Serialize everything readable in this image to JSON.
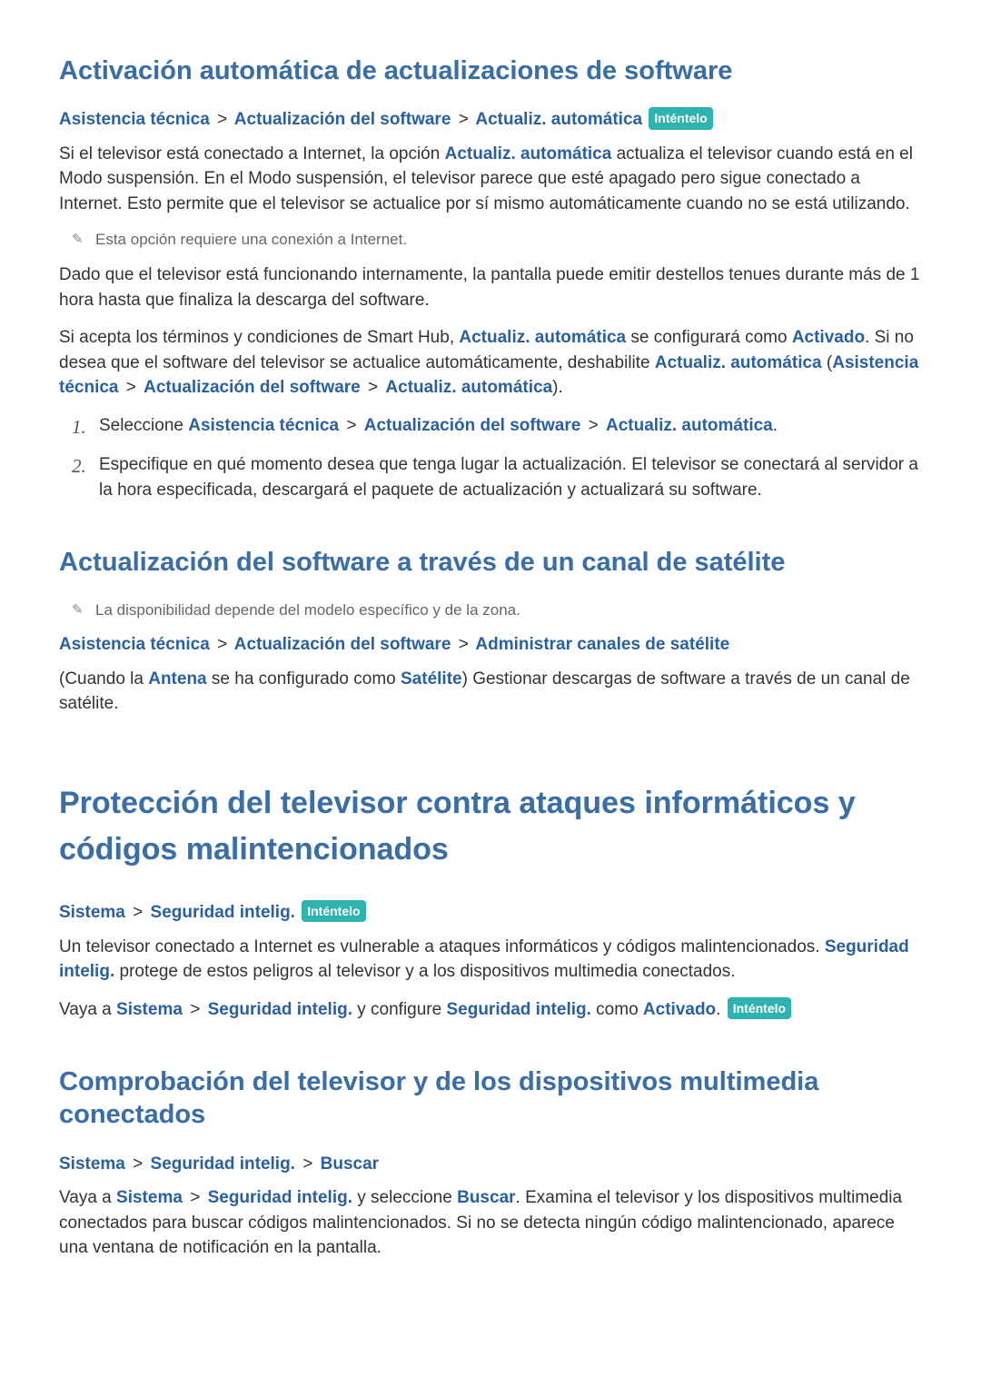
{
  "sec1": {
    "title": "Activación automática de actualizaciones de software",
    "bc": {
      "a": "Asistencia técnica",
      "b": "Actualización del software",
      "c": "Actualiz. automática",
      "try": "Inténtelo"
    },
    "p1_a": "Si el televisor está conectado a Internet, la opción ",
    "p1_b": "Actualiz. automática",
    "p1_c": " actualiza el televisor cuando está en el Modo suspensión. En el Modo suspensión, el televisor parece que esté apagado pero sigue conectado a Internet. Esto permite que el televisor se actualice por sí mismo automáticamente cuando no se está utilizando.",
    "note1": "Esta opción requiere una conexión a Internet.",
    "p2": "Dado que el televisor está funcionando internamente, la pantalla puede emitir destellos tenues durante más de 1 hora hasta que finaliza la descarga del software.",
    "p3_a": "Si acepta los términos y condiciones de Smart Hub, ",
    "p3_b": "Actualiz. automática",
    "p3_c": " se configurará como ",
    "p3_d": "Activado",
    "p3_e": ". Si no desea que el software del televisor se actualice automáticamente, deshabilite ",
    "p3_f": "Actualiz. automática",
    "p3_g": " (",
    "p3_h": "Asistencia técnica",
    "p3_i": " > ",
    "p3_j": "Actualización del software",
    "p3_k": " > ",
    "p3_l": "Actualiz. automática",
    "p3_m": ").",
    "li1_a": "Seleccione ",
    "li1_b": "Asistencia técnica",
    "li1_c": "Actualización del software",
    "li1_d": "Actualiz. automática",
    "li1_e": ".",
    "li2": "Especifique en qué momento desea que tenga lugar la actualización. El televisor se conectará al servidor a la hora especificada, descargará el paquete de actualización y actualizará su software."
  },
  "sec2": {
    "title": "Actualización del software a través de un canal de satélite",
    "note": "La disponibilidad depende del modelo específico y de la zona.",
    "bc": {
      "a": "Asistencia técnica",
      "b": "Actualización del software",
      "c": "Administrar canales de satélite"
    },
    "p_a": "(Cuando la ",
    "p_b": "Antena",
    "p_c": " se ha configurado como ",
    "p_d": "Satélite",
    "p_e": ") Gestionar descargas de software a través de un canal de satélite."
  },
  "sec3": {
    "title": "Protección del televisor contra ataques informáticos y códigos malintencionados",
    "bc": {
      "a": "Sistema",
      "b": "Seguridad intelig.",
      "try": "Inténtelo"
    },
    "p1_a": "Un televisor conectado a Internet es vulnerable a ataques informáticos y códigos malintencionados. ",
    "p1_b": "Seguridad intelig.",
    "p1_c": " protege de estos peligros al televisor y a los dispositivos multimedia conectados.",
    "p2_a": "Vaya a ",
    "p2_b": "Sistema",
    "p2_c": "Seguridad intelig.",
    "p2_d": " y configure ",
    "p2_e": "Seguridad intelig.",
    "p2_f": " como ",
    "p2_g": "Activado",
    "p2_h": ". ",
    "p2_try": "Inténtelo"
  },
  "sec4": {
    "title": "Comprobación del televisor y de los dispositivos multimedia conectados",
    "bc": {
      "a": "Sistema",
      "b": "Seguridad intelig.",
      "c": "Buscar"
    },
    "p_a": "Vaya a ",
    "p_b": "Sistema",
    "p_c": "Seguridad intelig.",
    "p_d": " y seleccione ",
    "p_e": "Buscar",
    "p_f": ". Examina el televisor y los dispositivos multimedia conectados para buscar códigos malintencionados. Si no se detecta ningún código malintencionado, aparece una ventana de notificación en la pantalla."
  },
  "sep": ">"
}
